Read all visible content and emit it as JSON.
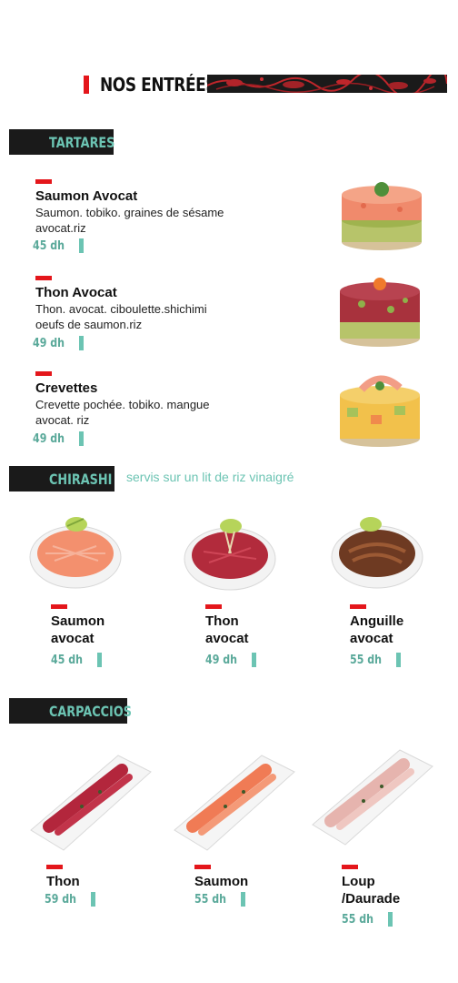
{
  "header": {
    "title": "NOS ENTRÉES"
  },
  "sections": {
    "tartares": {
      "title": "TARTARES",
      "items": [
        {
          "name": "Saumon Avocat",
          "desc1": "Saumon. tobiko. graines de sésame",
          "desc2": "avocat.riz",
          "price": "45 dh"
        },
        {
          "name": "Thon Avocat",
          "desc1": "Thon. avocat. ciboulette.shichimi",
          "desc2": "oeufs de saumon.riz",
          "price": "49 dh"
        },
        {
          "name": "Crevettes",
          "desc1": "Crevette pochée. tobiko. mangue",
          "desc2": "avocat. riz",
          "price": "49 dh"
        }
      ]
    },
    "chirashi": {
      "title": "CHIRASHI",
      "note": "servis sur un lit de riz vinaigré",
      "items": [
        {
          "name1": "Saumon",
          "name2": "avocat",
          "price": "45 dh"
        },
        {
          "name1": "Thon",
          "name2": "avocat",
          "price": "49 dh"
        },
        {
          "name1": "Anguille",
          "name2": "avocat",
          "price": "55 dh"
        }
      ]
    },
    "carpaccios": {
      "title": "CARPACCIOS",
      "items": [
        {
          "name1": "Thon",
          "name2": "",
          "price": "59 dh"
        },
        {
          "name1": "Saumon",
          "name2": "",
          "price": "55 dh"
        },
        {
          "name1": "Loup",
          "name2": "/Daurade",
          "price": "55 dh"
        }
      ]
    }
  },
  "colors": {
    "accent_red": "#e4161b",
    "accent_teal": "#6cc4b3",
    "tab_bg": "#1a1a1a"
  }
}
